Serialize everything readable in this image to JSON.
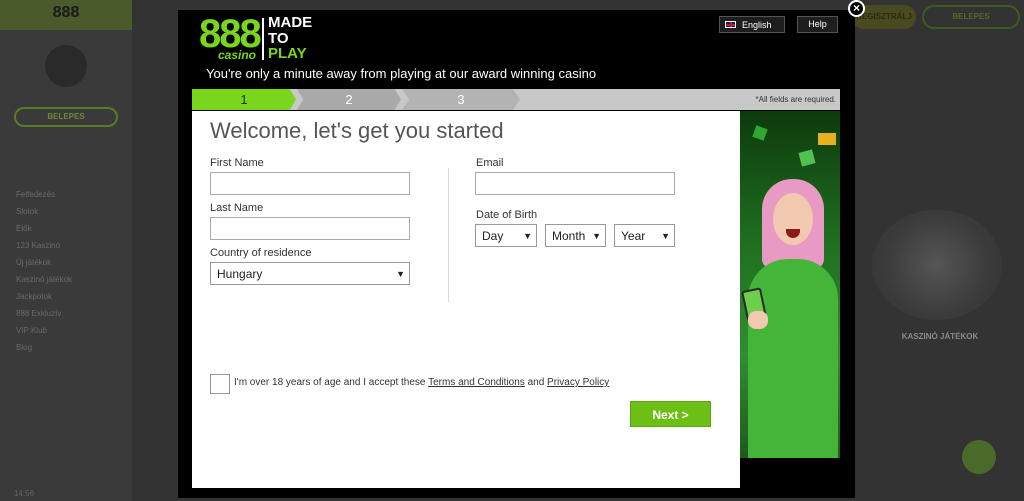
{
  "background": {
    "logo": "888",
    "login_button": "BELEPES",
    "nav_items": [
      "Felfedezés",
      "Slotok",
      "Élők",
      "123 Kaszinó",
      "Új játékok",
      "Kaszinó játékok",
      "Jackpotok",
      "888 Exkluzív",
      "VIP Klub",
      "Blog"
    ],
    "top_button_1": "REGISZTRÁLJ",
    "top_button_2": "BELEPES",
    "caption": "KASZINÓ JÁTÉKOK",
    "time": "14:56"
  },
  "modal": {
    "brand": {
      "logo": "888",
      "sub": "casino",
      "made": "MADE",
      "to": "TO",
      "play": "PLAY"
    },
    "tagline": "You're only a minute away from playing at our award winning casino",
    "language": "English",
    "help": "Help",
    "steps": [
      "1",
      "2",
      "3"
    ],
    "required_note": "*All fields are required.",
    "welcome": "Welcome, let's get you started",
    "fields": {
      "first_name_label": "First Name",
      "first_name_value": "",
      "last_name_label": "Last Name",
      "last_name_value": "",
      "country_label": "Country of residence",
      "country_value": "Hungary",
      "email_label": "Email",
      "email_value": "",
      "dob_label": "Date of Birth",
      "dob_day": "Day",
      "dob_month": "Month",
      "dob_year": "Year"
    },
    "terms": {
      "prefix": "I'm over 18 years of age and I accept these",
      "terms_link": "Terms and Conditions",
      "and": "and",
      "privacy_link": "Privacy Policy"
    },
    "next_button": "Next >",
    "close": "×"
  },
  "colors": {
    "brand_green": "#7ad61d",
    "button_green": "#6cbf14"
  }
}
